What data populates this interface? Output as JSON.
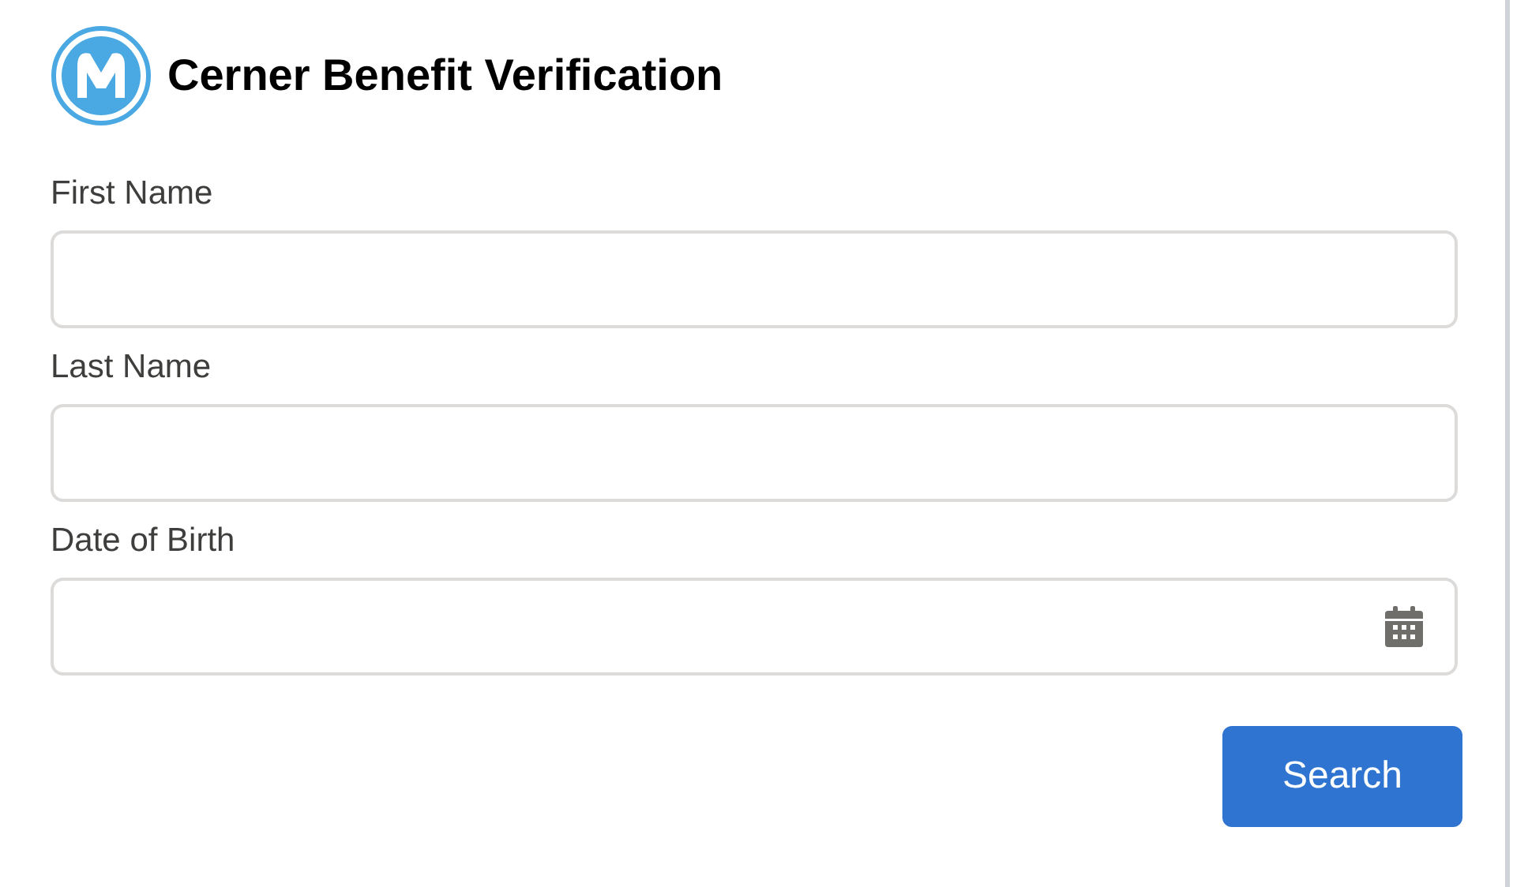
{
  "header": {
    "title": "Cerner Benefit Verification"
  },
  "fields": [
    {
      "label": "First Name",
      "kind": "text"
    },
    {
      "label": "Last Name",
      "kind": "text"
    },
    {
      "label": "Date of Birth",
      "kind": "date"
    }
  ],
  "buttons": [
    {
      "label": "Search"
    }
  ]
}
